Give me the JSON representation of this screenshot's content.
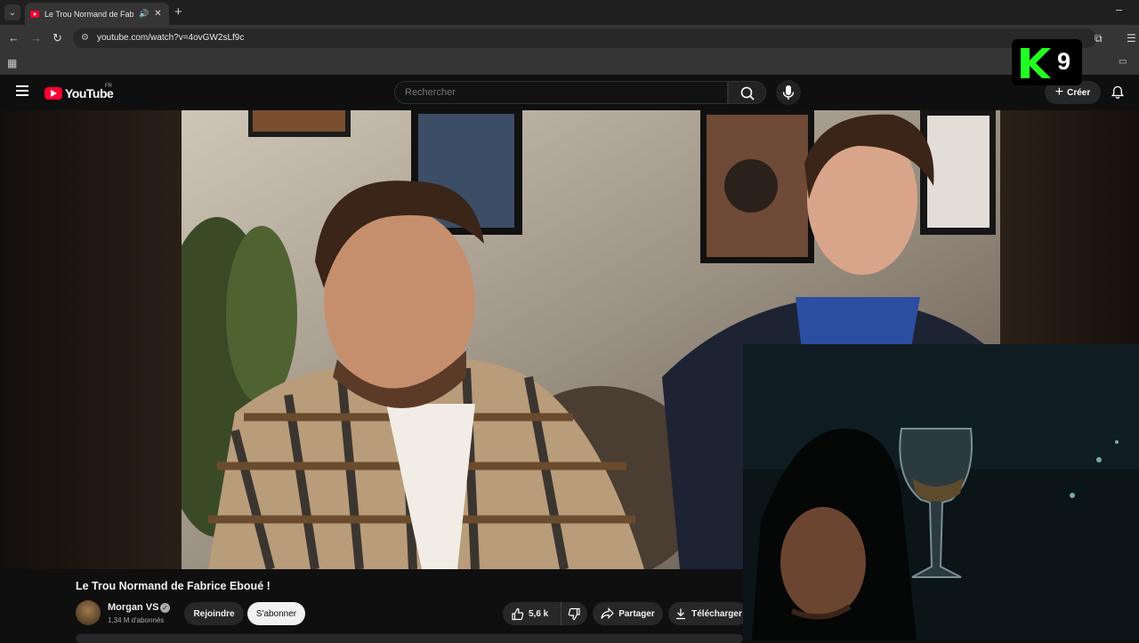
{
  "browser": {
    "tab_title": "Le Trou Normand de Fabric",
    "url": "youtube.com/watch?v=4ovGW2sLf9c"
  },
  "header": {
    "logo_text": "YouTube",
    "country_code": "FR",
    "search_placeholder": "Rechercher",
    "create_label": "Créer"
  },
  "overlay": {
    "channel_logo_number": "9"
  },
  "video": {
    "title": "Le Trou Normand de Fabrice Eboué !",
    "channel_name": "Morgan VS",
    "subscribers": "1,34 M d'abonnés",
    "join_label": "Rejoindre",
    "subscribe_label": "S'abonner",
    "likes": "5,6 k",
    "share_label": "Partager",
    "download_label": "Télécharger"
  },
  "colors": {
    "brand_red": "#ff0033",
    "overlay_green": "#22ff22",
    "page_bg": "#0f0f0f"
  }
}
